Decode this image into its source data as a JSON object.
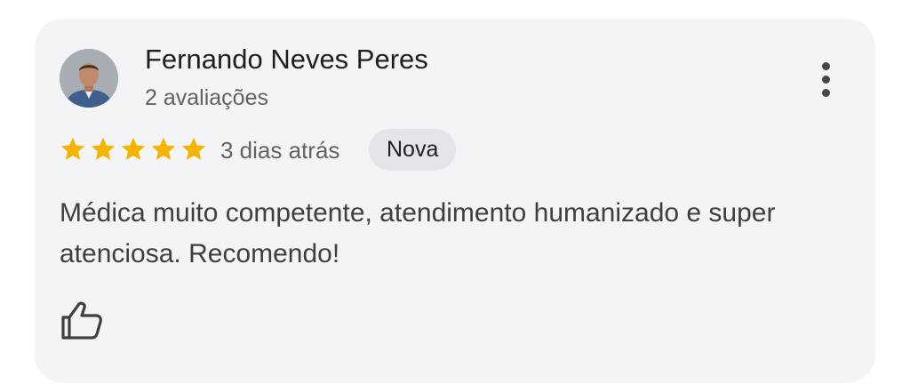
{
  "review": {
    "author_name": "Fernando Neves Peres",
    "author_review_count": "2 avaliações",
    "rating": 5,
    "rating_max": 5,
    "date": "3 dias atrás",
    "badge": "Nova",
    "text": "Médica muito competente, atendimento humanizado e super atenciosa. Recomendo!"
  },
  "icons": {
    "avatar": "person-photo",
    "more": "more-vert-icon",
    "star": "star-icon",
    "like": "thumb-up-icon"
  },
  "colors": {
    "card_background": "#f3f4f6",
    "star": "#f5b400",
    "badge_background": "#e3e5e8",
    "name_text": "#1f1f1f",
    "secondary_text": "#5f6368",
    "body_text": "#3c4043"
  }
}
